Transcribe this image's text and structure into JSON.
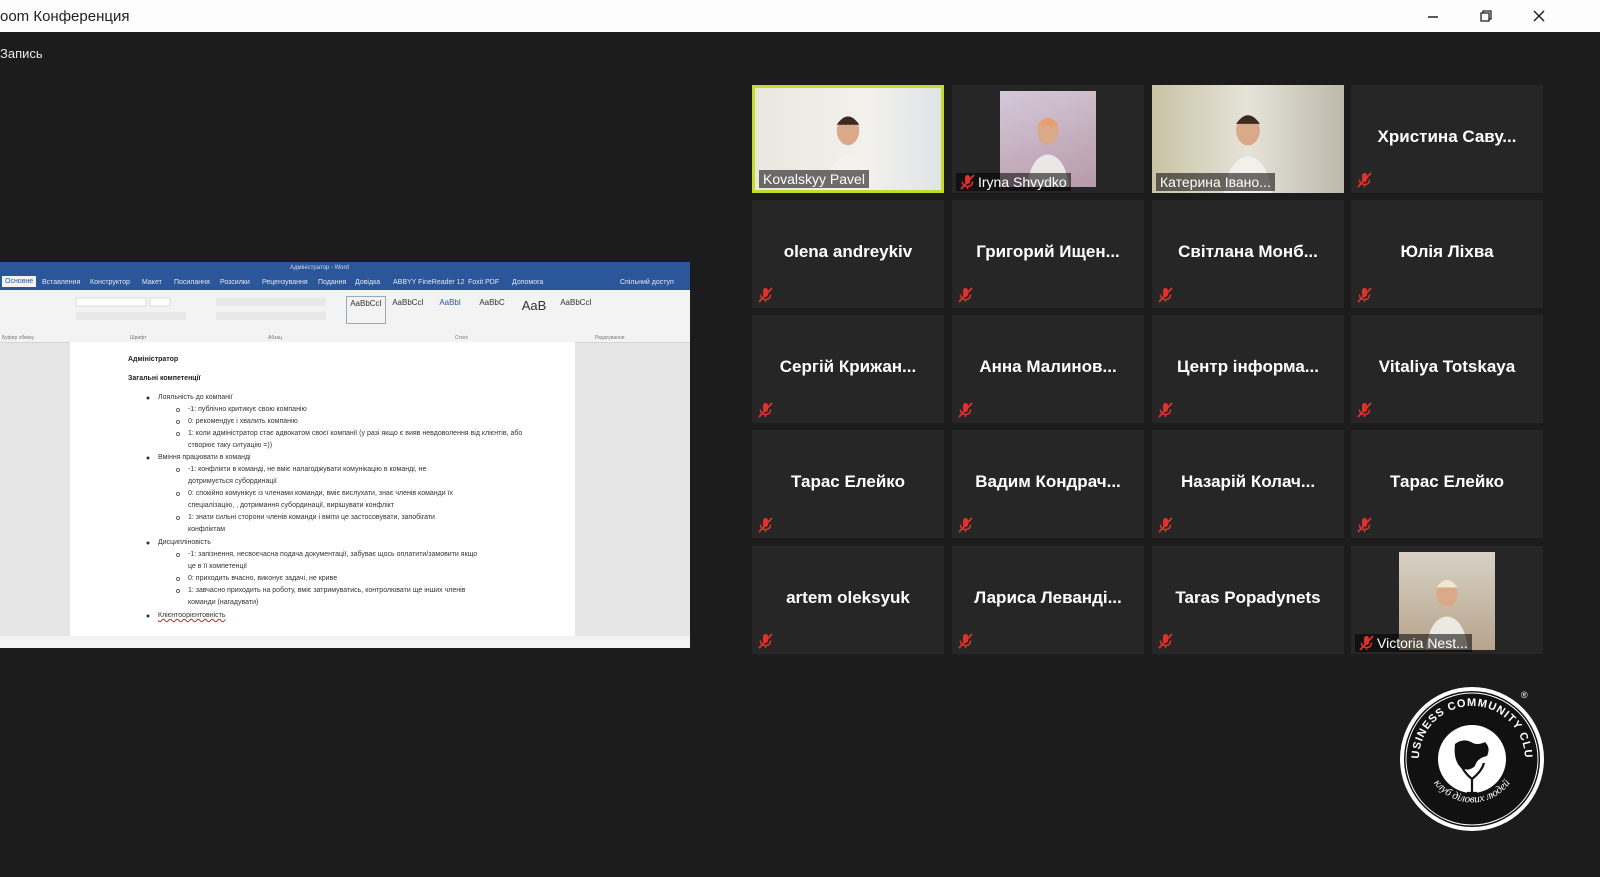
{
  "window": {
    "title": "oom Конференция"
  },
  "recording_label": "Запись",
  "share": {
    "ribbon_title": "Адміністратор - Word",
    "tabs": [
      "Основне",
      "Вставлення",
      "Конструктор",
      "Макет",
      "Посилання",
      "Розсилки",
      "Рецензування",
      "Подання",
      "Довідка",
      "ABBYY FineReader 12",
      "Foxit PDF",
      "Допомога",
      "Спільний доступ"
    ],
    "style_samples": [
      "AaBbCcI",
      "AaBbCcI",
      "AaBbl",
      "AaBbC",
      "AaB",
      "AaBbCcI"
    ],
    "groups": [
      "Буфер обміну",
      "Шрифт",
      "Абзац",
      "Стилі",
      "Редагування"
    ],
    "doc": {
      "heading": "Адміністратор",
      "subheading": "Загальні компетенції",
      "lines": [
        "Лояльність до компанії",
        "-1: публічно критикує свою компанію",
        "0: рекомендує і хвалить компанію",
        "1: коли адміністратор стає адвокатом своєї компанії (у разі якщо є вияв невдоволення від клієнтів, або",
        "створює таку ситуацію =))",
        "Вміння працювати в команді",
        "-1: конфлікти в команді, не вміє налагоджувати комунікацію в команді, не",
        "дотримується субординації",
        "0: спокійно комунікує із членами команди, вміє вислухати, знає членів команди їх",
        "спеціалізацію, , дотримання субординації, вирішувати конфлікт",
        "1: знати сильні сторони членів команди і вміти це застосовувати, запобігати",
        "конфліктам",
        "Дисципліновість",
        "-1: запізнення, несвоєчасна подача документації, забуває щось оплатити/замовити якщо",
        "це в її компетенції",
        "0: приходить вчасно, виконує задачі, не криве",
        "1: завчасно приходить на роботу, вміє затримуватись, контролювати ще інших членів",
        "команди (нагадувати)",
        "Клієнтоорієнтовність"
      ]
    }
  },
  "participants": [
    {
      "name": "Kovalskyy Pavel",
      "video": true,
      "active": true,
      "muted": false
    },
    {
      "name": "Iryna Shvydko",
      "video": true,
      "active": false,
      "muted": true
    },
    {
      "name": "Катерина  Івано...",
      "video": true,
      "active": false,
      "muted": false
    },
    {
      "name": "Христина  Саву...",
      "video": false,
      "muted": true
    },
    {
      "name": "olena andreykiv",
      "video": false,
      "muted": true
    },
    {
      "name": "Григорий  Ищен...",
      "video": false,
      "muted": true
    },
    {
      "name": "Світлана  Монб...",
      "video": false,
      "muted": true
    },
    {
      "name": "Юлія Ліхва",
      "video": false,
      "muted": true
    },
    {
      "name": "Сергій  Крижан...",
      "video": false,
      "muted": true
    },
    {
      "name": "Анна  Малинов...",
      "video": false,
      "muted": true
    },
    {
      "name": "Центр  інформа...",
      "video": false,
      "muted": true
    },
    {
      "name": "Vitaliya Totskaya",
      "video": false,
      "muted": true
    },
    {
      "name": "Тарас Елейко",
      "video": false,
      "muted": true
    },
    {
      "name": "Вадим  Кондрач...",
      "video": false,
      "muted": true
    },
    {
      "name": "Назарій  Колач...",
      "video": false,
      "muted": true
    },
    {
      "name": "Тарас Елейко",
      "video": false,
      "muted": true
    },
    {
      "name": "artem oleksyuk",
      "video": false,
      "muted": true
    },
    {
      "name": "Лариса  Леванді...",
      "video": false,
      "muted": true
    },
    {
      "name": "Taras Popadynets",
      "video": false,
      "muted": true
    },
    {
      "name": "Victoria Nest...",
      "video": true,
      "active": false,
      "muted": true
    }
  ],
  "logo": {
    "top_text": "BUSINESS COMMUNITY CLUB",
    "bottom_text": "клуб ділових людей",
    "mark": "®"
  },
  "colors": {
    "background": "#1c1c1c",
    "tile": "#262626",
    "active_border": "#c7dc2a",
    "muted_icon": "#e0312b",
    "word_blue": "#2b579a"
  }
}
